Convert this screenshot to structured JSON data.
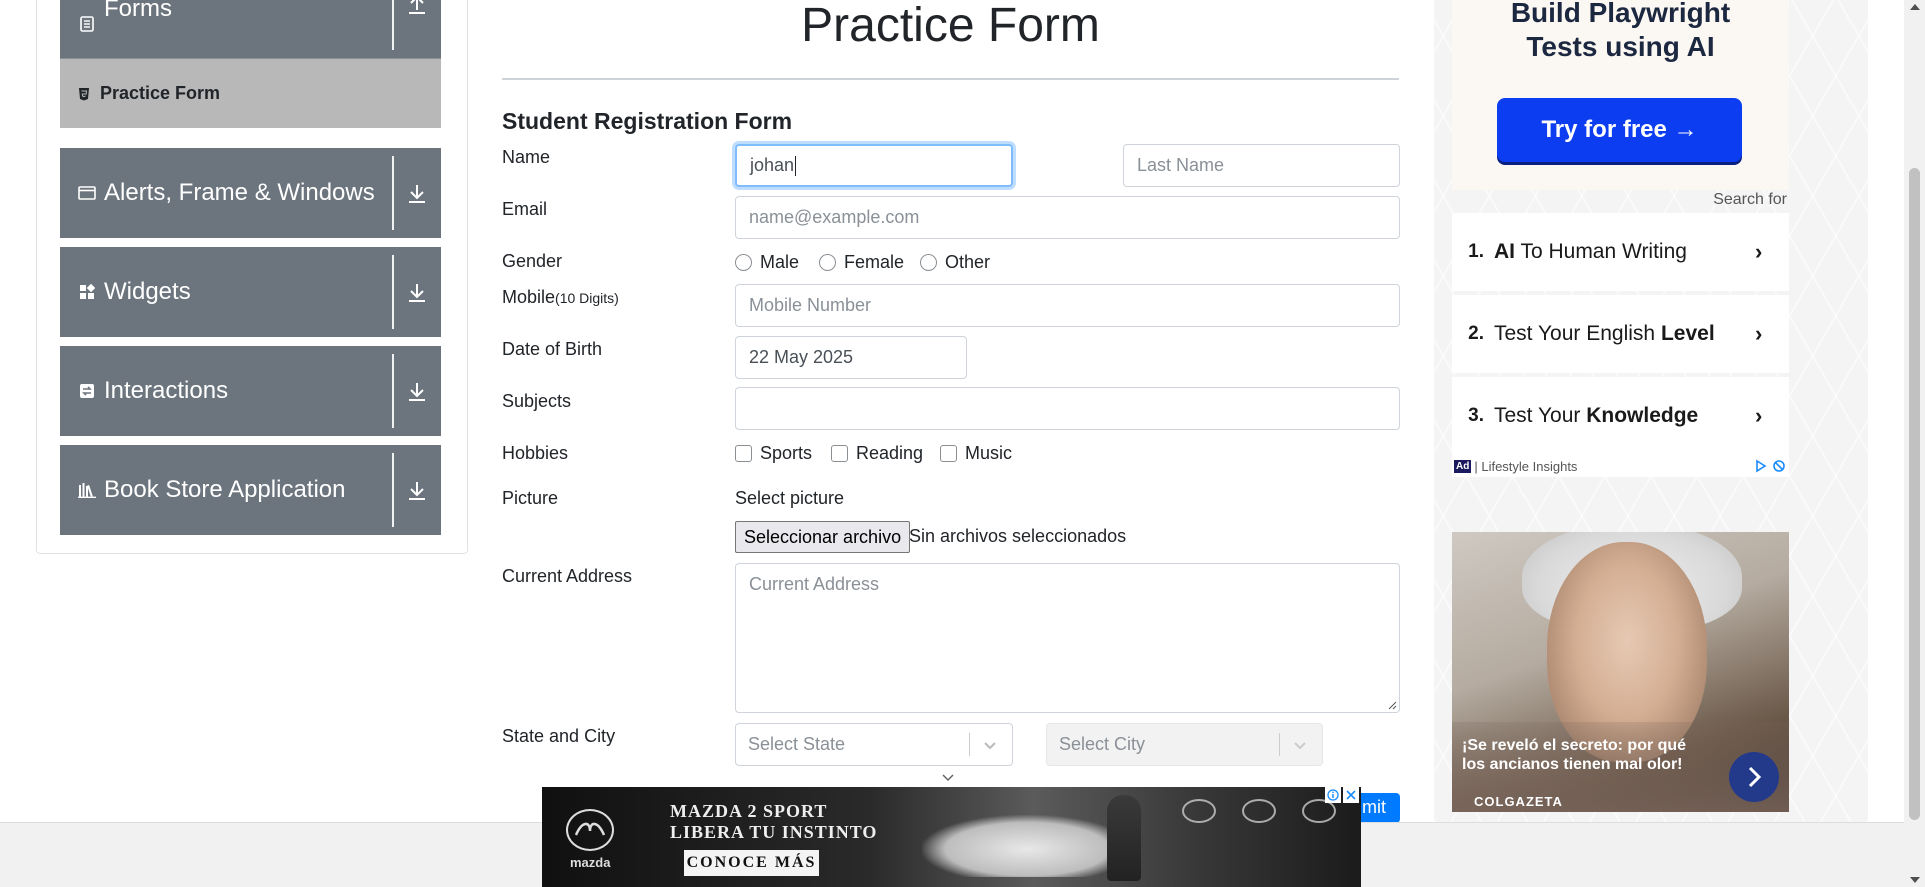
{
  "sidebar": {
    "groups": [
      {
        "label": "Forms",
        "icon": "document-icon",
        "arrow": "collapse-up-arrow"
      },
      {
        "label": "Alerts, Frame & Windows",
        "icon": "window-icon",
        "arrow": "expand-down-arrow"
      },
      {
        "label": "Widgets",
        "icon": "widgets-icon",
        "arrow": "expand-down-arrow"
      },
      {
        "label": "Interactions",
        "icon": "interactions-icon",
        "arrow": "expand-down-arrow"
      },
      {
        "label": "Book Store Application",
        "icon": "books-icon",
        "arrow": "expand-down-arrow"
      }
    ],
    "active_item": "Practice Form"
  },
  "main": {
    "title": "Practice Form",
    "form_heading": "Student Registration Form",
    "labels": {
      "name": "Name",
      "email": "Email",
      "gender": "Gender",
      "mobile": "Mobile",
      "mobile_hint": "(10 Digits)",
      "dob": "Date of Birth",
      "subjects": "Subjects",
      "hobbies": "Hobbies",
      "picture": "Picture",
      "current_address": "Current Address",
      "state_city": "State and City"
    },
    "fields": {
      "first_name_value": "johan",
      "last_name_placeholder": "Last Name",
      "email_placeholder": "name@example.com",
      "mobile_placeholder": "Mobile Number",
      "dob_value": "22 May 2025",
      "subjects_value": "",
      "address_placeholder": "Current Address",
      "state_placeholder": "Select State",
      "city_placeholder": "Select City"
    },
    "gender_options": [
      "Male",
      "Female",
      "Other"
    ],
    "hobby_options": [
      "Sports",
      "Reading",
      "Music"
    ],
    "picture": {
      "prompt": "Select picture",
      "button": "Seleccionar archivo",
      "status": "Sin archivos seleccionados"
    },
    "submit_label": "mit"
  },
  "ads": {
    "top": {
      "headline_line1": "Build Playwright",
      "headline_line2": "Tests using AI",
      "cta": "Try for free →"
    },
    "search_for": "Search for",
    "items": [
      {
        "num": "1.",
        "bold": "AI",
        "rest": " To Human Writing",
        "arrow": "›"
      },
      {
        "num": "2.",
        "pre": "Test Your English ",
        "bold": "Level",
        "arrow": "›"
      },
      {
        "num": "3.",
        "pre": "Test Your ",
        "bold": "Knowledge",
        "arrow": "›"
      }
    ],
    "footer_badge": "Ad",
    "footer_source": "| Lifestyle Insights",
    "photo_caption": "¡Se reveló el secreto: por qué los ancianos tienen mal olor!",
    "photo_brand": "COLGAZETA",
    "banner": {
      "logo_text": "mazda",
      "headline_line1": "MAZDA 2 SPORT",
      "headline_line2": "LIBERA TU INSTINTO",
      "cta": "CONOCE MÁS"
    }
  },
  "colors": {
    "sidebar_group": "#6c757d",
    "sidebar_active": "#b8b8b8",
    "focus_border": "#80bdff",
    "ad_cta": "#0c3df0",
    "submit": "#007bff"
  }
}
